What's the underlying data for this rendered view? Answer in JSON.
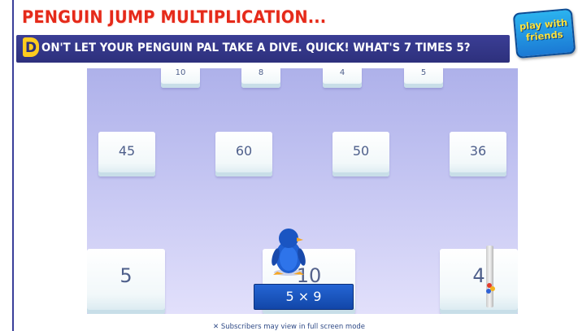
{
  "header": {
    "title": "PENGUIN JUMP MULTIPLICATION...",
    "subtitle_initial": "D",
    "subtitle_rest": "ON'T LET YOUR PENGUIN PAL TAKE A DIVE. QUICK! WHAT'S 7 TIMES 5?"
  },
  "badge": {
    "line1": "play with",
    "line2": "friends"
  },
  "game": {
    "top_row": [
      "10",
      "8",
      "4",
      "5"
    ],
    "middle_row": [
      "45",
      "60",
      "50",
      "36"
    ],
    "bottom_row": [
      "5",
      "10",
      "4"
    ],
    "question": "5 × 9"
  },
  "footer": {
    "note": "Subscribers may view in full screen mode"
  },
  "colors": {
    "title_red": "#e52a1a",
    "banner_navy": "#2d307c",
    "question_blue": "#1d56c2",
    "penguin_blue": "#1f5fd1"
  }
}
